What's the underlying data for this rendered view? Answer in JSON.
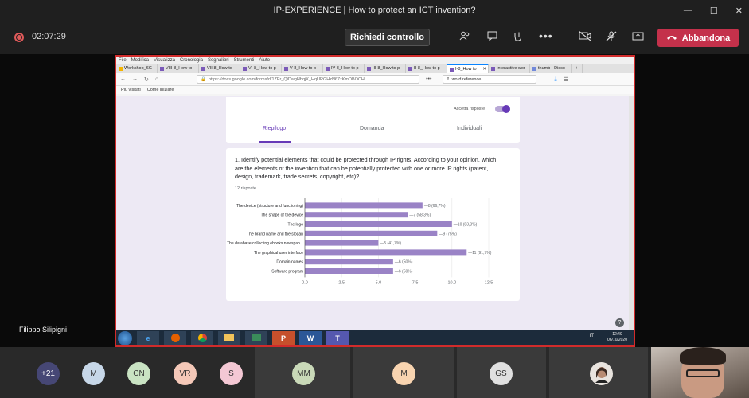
{
  "window": {
    "title": "IP-EXPERIENCE | How to protect an ICT invention?",
    "controls": [
      "—",
      "☐",
      "✕"
    ]
  },
  "call": {
    "timer": "02:07:29",
    "request_control_label": "Richiedi controllo",
    "leave_label": "Abbandona",
    "presenter_name": "Filippo Silipigni"
  },
  "browser": {
    "menu": [
      "File",
      "Modifica",
      "Visualizza",
      "Cronologia",
      "Segnalibri",
      "Strumenti",
      "Aiuto"
    ],
    "tabs": [
      {
        "label": "Workshop_6G"
      },
      {
        "label": "VIII-8_How to"
      },
      {
        "label": "VII-8_How to"
      },
      {
        "label": "VI-8_How to p"
      },
      {
        "label": "V-8_How to p"
      },
      {
        "label": "IV-8_How to p"
      },
      {
        "label": "III-8_How to p"
      },
      {
        "label": "II-8_How to p"
      },
      {
        "label": "I-8_How to"
      },
      {
        "label": "Interactive wor"
      },
      {
        "label": "thumb - Disco"
      }
    ],
    "url": "https://docs.google.com/forms/d/1ZEr_QiDwgHbqjX_HqURGHzN67zKmDBOCH",
    "search_value": "word reference",
    "bookmarks": [
      "Più visitati",
      "Come iniziare"
    ]
  },
  "form": {
    "accept_label": "Accetta risposte",
    "tabs": [
      "Riepilogo",
      "Domanda",
      "Individuali"
    ],
    "question": "1. Identify potential elements that could be protected through IP rights. According to your opinion, which are the elements of the invention that can be potentially protected with one or more IP rights (patent, design, trademark, trade secrets, copyright, etc)?",
    "responses": "12 risposte"
  },
  "chart_data": {
    "type": "bar",
    "orientation": "horizontal",
    "categories": [
      "The device (structure and functioning)",
      "The shape of the device",
      "The logo",
      "The brand name and the slogan",
      "The database collecting ebooks newspap...",
      "The graphical user interface",
      "Domain names",
      "Software program"
    ],
    "values": [
      8,
      7,
      10,
      9,
      5,
      11,
      6,
      6
    ],
    "data_labels": [
      "8 (66,7%)",
      "7 (58,3%)",
      "10 (83,3%)",
      "9 (75%)",
      "5 (41,7%)",
      "11 (91,7%)",
      "6 (50%)",
      "6 (50%)"
    ],
    "xticks": [
      "0.0",
      "2.5",
      "5.0",
      "7.5",
      "10.0",
      "12.5"
    ],
    "xlim": [
      0,
      12.5
    ],
    "color": "#9a83c6"
  },
  "taskbar": {
    "apps": [
      "e",
      "",
      "",
      "",
      "",
      "P",
      "W",
      "T"
    ],
    "tray": "IT",
    "time": "12:49",
    "date": "06/10/2020"
  },
  "participants": [
    {
      "initials": "+21",
      "color": "#464775",
      "text_color": "#ffffff"
    },
    {
      "initials": "M",
      "color": "#c7d7e8",
      "text_color": "#333333"
    },
    {
      "initials": "CN",
      "color": "#c9e3c3",
      "text_color": "#333333"
    },
    {
      "initials": "VR",
      "color": "#f4c8b8",
      "text_color": "#333333"
    },
    {
      "initials": "S",
      "color": "#f4c8d4",
      "text_color": "#333333"
    },
    {
      "initials": "MM",
      "color": "#c9d9b8",
      "text_color": "#333333"
    },
    {
      "initials": "M",
      "color": "#f8d4b0",
      "text_color": "#333333"
    },
    {
      "initials": "GS",
      "color": "#e0e0e0",
      "text_color": "#333333"
    }
  ]
}
